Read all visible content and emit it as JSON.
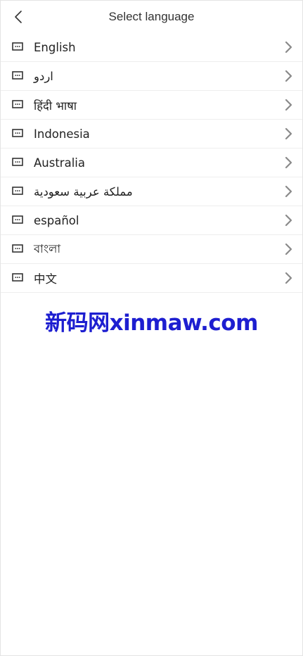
{
  "header": {
    "title": "Select language"
  },
  "languages": [
    {
      "label": "English"
    },
    {
      "label": "اردو"
    },
    {
      "label": "हिंदी भाषा"
    },
    {
      "label": "Indonesia"
    },
    {
      "label": "Australia"
    },
    {
      "label": "مملكة عربية سعودية"
    },
    {
      "label": "español"
    },
    {
      "label": "বাংলা"
    },
    {
      "label": "中文"
    }
  ],
  "icons": {
    "back": "chevron-left-icon",
    "item": "keyboard-icon",
    "arrow": "chevron-right-icon"
  },
  "watermark": {
    "text": "新码网xinmaw.com",
    "color": "#1d1ed0"
  }
}
